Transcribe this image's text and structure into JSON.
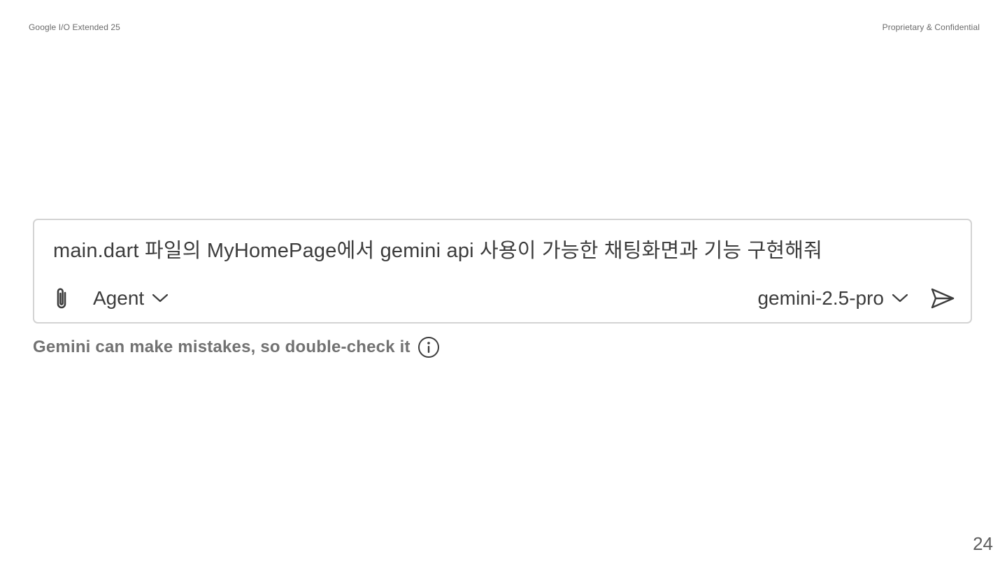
{
  "header": {
    "left": "Google I/O Extended 25",
    "right": "Proprietary & Confidential"
  },
  "chat": {
    "prompt": "main.dart 파일의 MyHomePage에서 gemini api 사용이 가능한 채팅화면과 기능 구현해줘",
    "mode": "Agent",
    "model": "gemini-2.5-pro",
    "icons": {
      "attach": "paperclip-icon",
      "mode_dropdown": "chevron-down-icon",
      "model_dropdown": "chevron-down-icon",
      "send": "send-icon"
    }
  },
  "disclaimer": {
    "text": "Gemini can make mistakes, so double-check it",
    "icon": "info-icon"
  },
  "footer": {
    "page_number": "24"
  },
  "colors": {
    "border": "#d3d3d3",
    "text": "#3c3c3c",
    "muted": "#727272"
  }
}
